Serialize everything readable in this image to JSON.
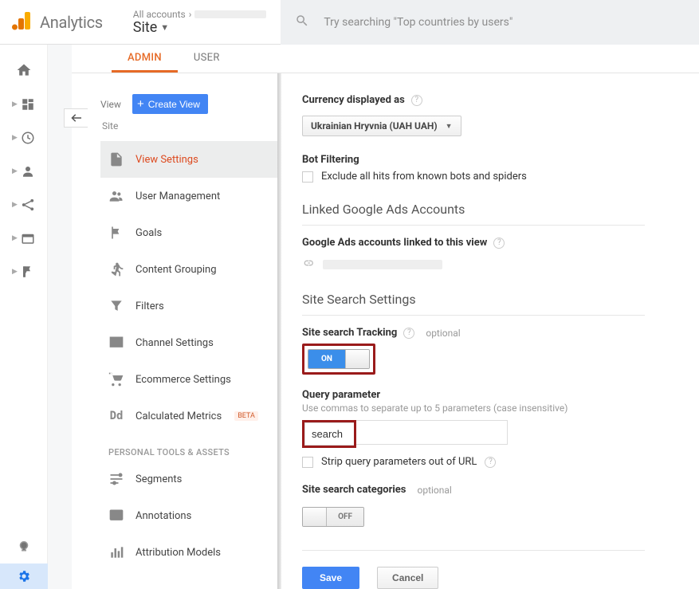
{
  "header": {
    "app_name": "Analytics",
    "breadcrumb_top": "All accounts",
    "breadcrumb_site": "Site",
    "search_placeholder": "Try searching \"Top countries by users\""
  },
  "tabs": {
    "admin": "ADMIN",
    "user": "USER"
  },
  "sidebar": {
    "view_label": "View",
    "create_view": "Create View",
    "site_label": "Site",
    "items": [
      {
        "label": "View Settings"
      },
      {
        "label": "User Management"
      },
      {
        "label": "Goals"
      },
      {
        "label": "Content Grouping"
      },
      {
        "label": "Filters"
      },
      {
        "label": "Channel Settings"
      },
      {
        "label": "Ecommerce Settings"
      },
      {
        "label": "Calculated Metrics",
        "beta": "BETA"
      }
    ],
    "section_heading": "PERSONAL TOOLS & ASSETS",
    "items2": [
      {
        "label": "Segments"
      },
      {
        "label": "Annotations"
      },
      {
        "label": "Attribution Models"
      }
    ]
  },
  "detail": {
    "currency_label": "Currency displayed as",
    "currency_value": "Ukrainian Hryvnia (UAH UAH)",
    "bot_filtering_title": "Bot Filtering",
    "bot_filtering_check": "Exclude all hits from known bots and spiders",
    "linked_heading": "Linked Google Ads Accounts",
    "linked_sub": "Google Ads accounts linked to this view",
    "site_search_heading": "Site Search Settings",
    "ss_tracking_label": "Site search Tracking",
    "optional": "optional",
    "on": "ON",
    "off": "OFF",
    "query_param_label": "Query parameter",
    "query_param_help": "Use commas to separate up to 5 parameters (case insensitive)",
    "query_param_value": "search",
    "strip_label": "Strip query parameters out of URL",
    "ss_categories_label": "Site search categories",
    "save": "Save",
    "cancel": "Cancel"
  }
}
